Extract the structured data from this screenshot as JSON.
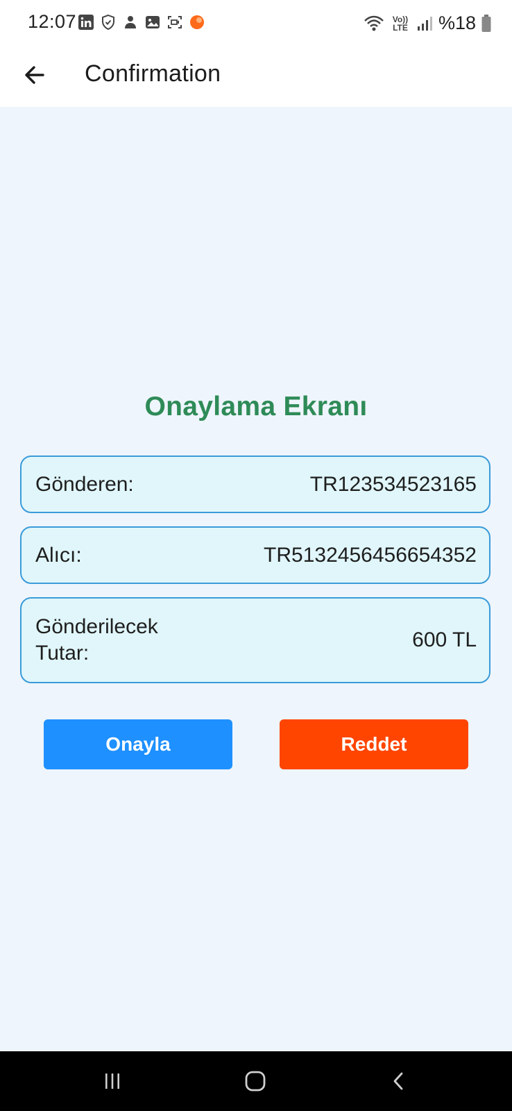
{
  "status_bar": {
    "time": "12:07",
    "battery": "%18",
    "left_icons": [
      "linkedin-icon",
      "shield-check-icon",
      "user-icon",
      "gallery-icon",
      "screen-record-icon",
      "notification-dot-icon"
    ],
    "right_icons": [
      "wifi-icon",
      "volte-icon",
      "signal-icon",
      "battery-icon"
    ],
    "network_label": "Vo)) LTE"
  },
  "app_bar": {
    "title": "Confirmation",
    "back_icon": "arrow-left-icon"
  },
  "main": {
    "heading": "Onaylama Ekranı",
    "rows": [
      {
        "label": "Gönderen:",
        "value": "TR123534523165"
      },
      {
        "label": "Alıcı:",
        "value": "TR5132456456654352"
      },
      {
        "label": "Gönderilecek Tutar:",
        "value": "600 TL"
      }
    ],
    "approve_label": "Onayla",
    "reject_label": "Reddet"
  },
  "nav_bar": {
    "icons": [
      "recents-icon",
      "home-icon",
      "back-icon"
    ]
  },
  "colors": {
    "heading_green": "#2e8b57",
    "card_border": "#3a9bd9",
    "card_fill": "#e0f6fa",
    "content_bg": "#eef5fc",
    "approve_blue": "#1e90ff",
    "reject_orange": "#ff4500"
  }
}
